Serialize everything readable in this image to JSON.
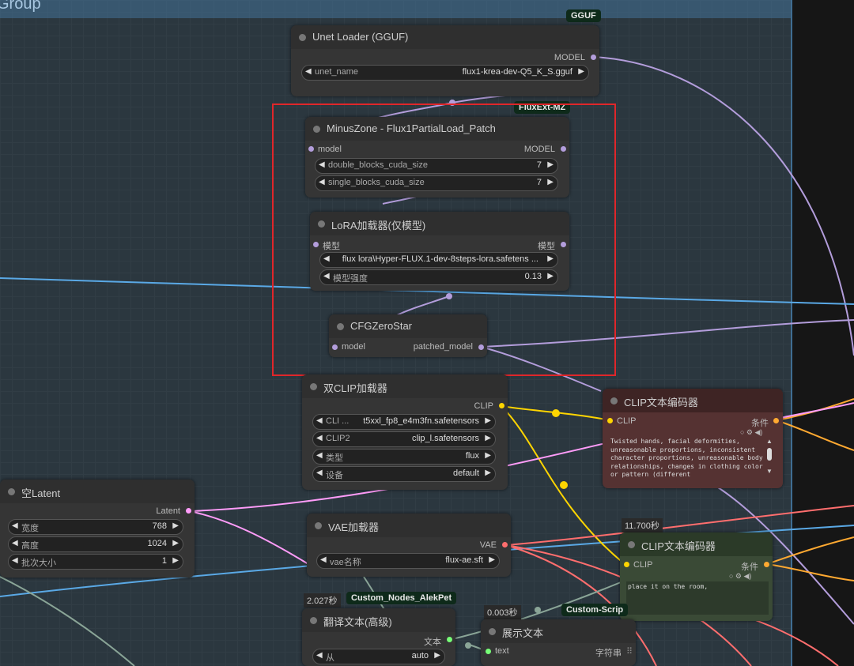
{
  "group": {
    "title": "Group"
  },
  "badges": {
    "gguf": "GGUF",
    "fluxext": "FluxExt-MZ",
    "alekpet": "Custom_Nodes_AlekPet",
    "customscript": "Custom-Scrip"
  },
  "timings": {
    "clip2": "11.700秒",
    "translate": "2.027秒",
    "show": "0.003秒"
  },
  "nodes": {
    "unet_loader": {
      "title": "Unet Loader (GGUF)",
      "output": "MODEL",
      "widgets": [
        {
          "label": "unet_name",
          "value": "flux1-krea-dev-Q5_K_S.gguf"
        }
      ]
    },
    "minuszone": {
      "title": "MinusZone - Flux1PartialLoad_Patch",
      "input": "model",
      "output": "MODEL",
      "widgets": [
        {
          "label": "double_blocks_cuda_size",
          "value": "7"
        },
        {
          "label": "single_blocks_cuda_size",
          "value": "7"
        }
      ]
    },
    "lora": {
      "title": "LoRA加载器(仅模型)",
      "input": "模型",
      "output": "模型",
      "widgets": [
        {
          "label": "",
          "value": "flux lora\\Hyper-FLUX.1-dev-8steps-lora.safetens ..."
        },
        {
          "label": "模型强度",
          "value": "0.13"
        }
      ]
    },
    "cfg": {
      "title": "CFGZeroStar",
      "input": "model",
      "output": "patched_model"
    },
    "dualclip": {
      "title": "双CLIP加载器",
      "output": "CLIP",
      "widgets": [
        {
          "label": "CLI ...",
          "value": "t5xxl_fp8_e4m3fn.safetensors"
        },
        {
          "label": "CLIP2",
          "value": "clip_l.safetensors"
        },
        {
          "label": "类型",
          "value": "flux"
        },
        {
          "label": "设备",
          "value": "default"
        }
      ]
    },
    "clip_neg": {
      "title": "CLIP文本编码器",
      "input": "CLIP",
      "output": "条件",
      "text": "Twisted hands, facial deformities, unreasonable proportions, inconsistent character proportions, unreasonable body relationships, changes in clothing color or pattern (different"
    },
    "latent": {
      "title": "空Latent",
      "output": "Latent",
      "widgets": [
        {
          "label": "宽度",
          "value": "768"
        },
        {
          "label": "高度",
          "value": "1024"
        },
        {
          "label": "批次大小",
          "value": "1"
        }
      ]
    },
    "vae": {
      "title": "VAE加载器",
      "output": "VAE",
      "widgets": [
        {
          "label": "vae名称",
          "value": "flux-ae.sft"
        }
      ]
    },
    "clip_pos": {
      "title": "CLIP文本编码器",
      "input": "CLIP",
      "output": "条件",
      "text": "place it on the room,"
    },
    "translate": {
      "title": "翻译文本(高级)",
      "output": "文本",
      "widgets": [
        {
          "label": "从",
          "value": "auto"
        }
      ]
    },
    "show": {
      "title": "展示文本",
      "input": "text",
      "output": "字符串"
    }
  },
  "colors": {
    "model": "#b39ddb",
    "clip": "#ffd500",
    "vae": "#ff6e6e",
    "latent": "#ff9cf9",
    "conditioning": "#ffa931",
    "string": "#77ff77",
    "highlight": "#e0262a"
  }
}
